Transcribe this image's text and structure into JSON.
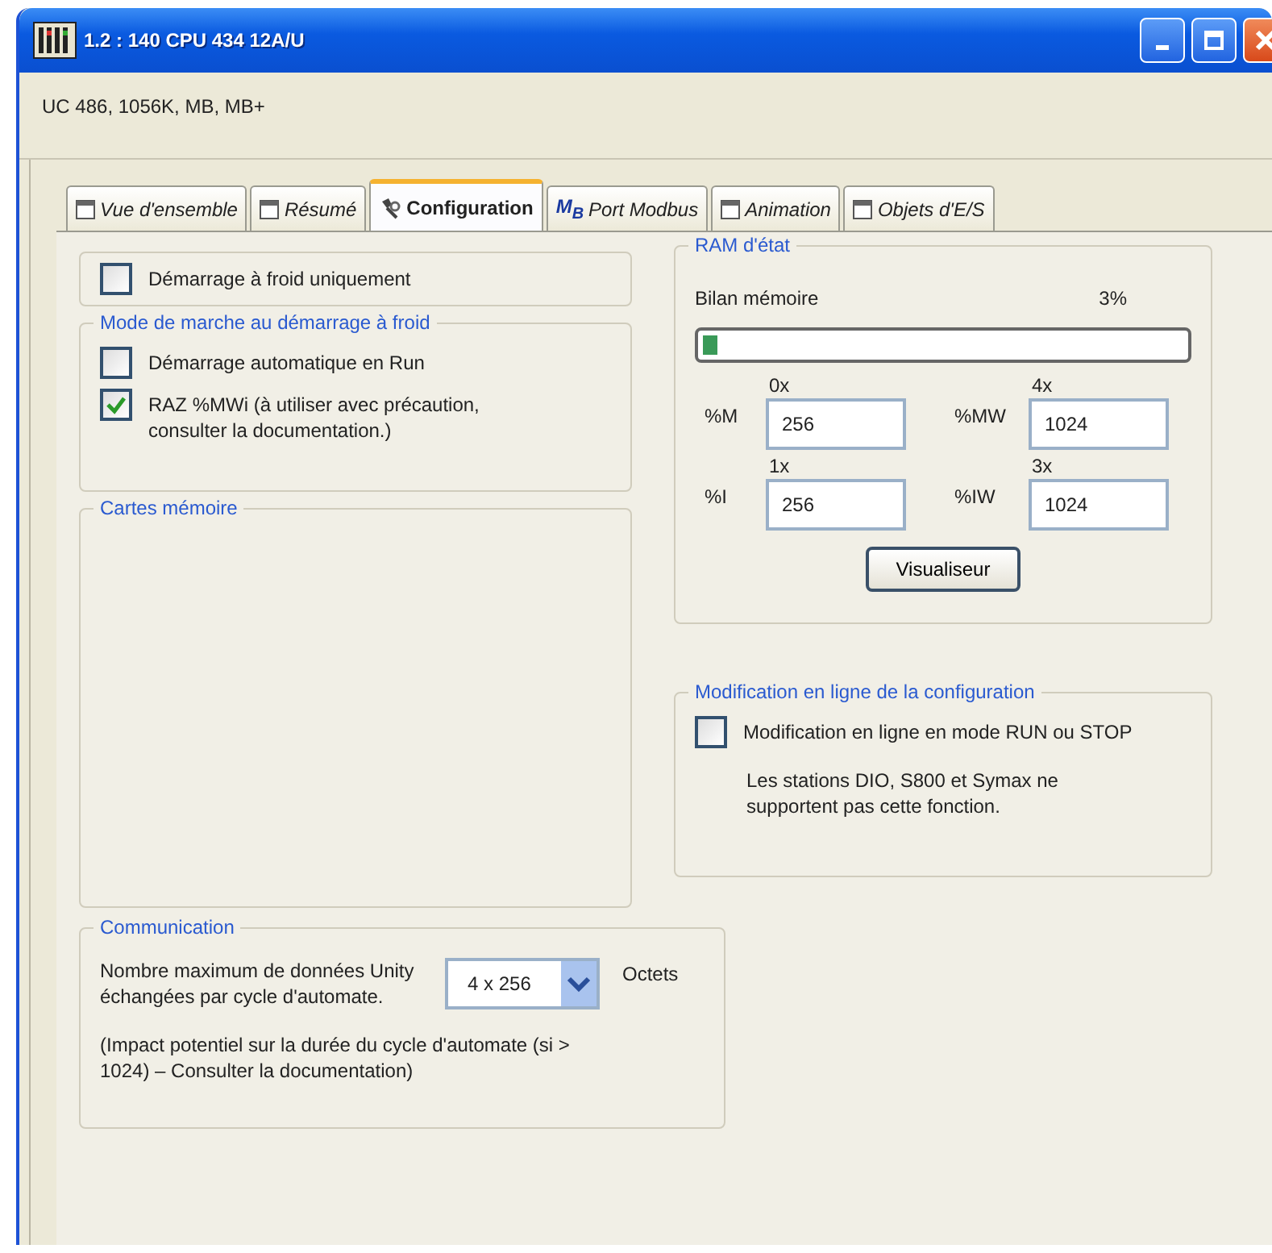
{
  "window": {
    "title": "1.2 : 140 CPU 434 12A/U"
  },
  "info": "UC 486, 1056K, MB, MB+",
  "tabs": [
    {
      "label": "Vue d'ensemble",
      "kind": "window",
      "selected": false
    },
    {
      "label": "Résumé",
      "kind": "window",
      "selected": false
    },
    {
      "label": "Configuration",
      "kind": "tool",
      "selected": true
    },
    {
      "label": "Port Modbus",
      "kind": "modbus",
      "icon_text": "M$_{B}$",
      "selected": false
    },
    {
      "label": "Animation",
      "kind": "window",
      "selected": false
    },
    {
      "label": "Objets d'E/S",
      "kind": "window",
      "selected": false
    }
  ],
  "cold_start_only": {
    "label": "Démarrage à froid uniquement",
    "checked": false
  },
  "run_mode": {
    "title": "Mode de marche au démarrage à froid",
    "options": [
      {
        "label": "Démarrage automatique en Run",
        "checked": false
      },
      {
        "label": "RAZ %MWi (à utiliser avec précaution, consulter la documentation.)",
        "checked": true
      }
    ]
  },
  "memory_cards": {
    "title": "Cartes mémoire"
  },
  "ram": {
    "title": "RAM d'état",
    "label": "Bilan mémoire",
    "reading": "3%",
    "level": 0.03,
    "fields": [
      {
        "label": "%M",
        "header": "0x",
        "value": "256"
      },
      {
        "label": "%MW",
        "header": "4x",
        "value": "1024"
      },
      {
        "label": "%I",
        "header": "1x",
        "value": "256"
      },
      {
        "label": "%IW",
        "header": "3x",
        "value": "1024"
      }
    ],
    "button": "Visualiseur"
  },
  "online_modification": {
    "title": "Modification en ligne de la configuration",
    "checkbox": {
      "label": "Modification en ligne en mode RUN ou STOP",
      "checked": false
    },
    "note": "Les stations DIO, S800 et Symax ne supportent pas cette fonction."
  },
  "communication": {
    "title": "Communication",
    "label": "Nombre maximum de données Unity échangées par cycle d'automate.",
    "value": "4 x 256",
    "unit": "Octets",
    "note": "(Impact potentiel sur la durée du cycle d'automate (si > 1024) – Consulter la documentation)"
  }
}
